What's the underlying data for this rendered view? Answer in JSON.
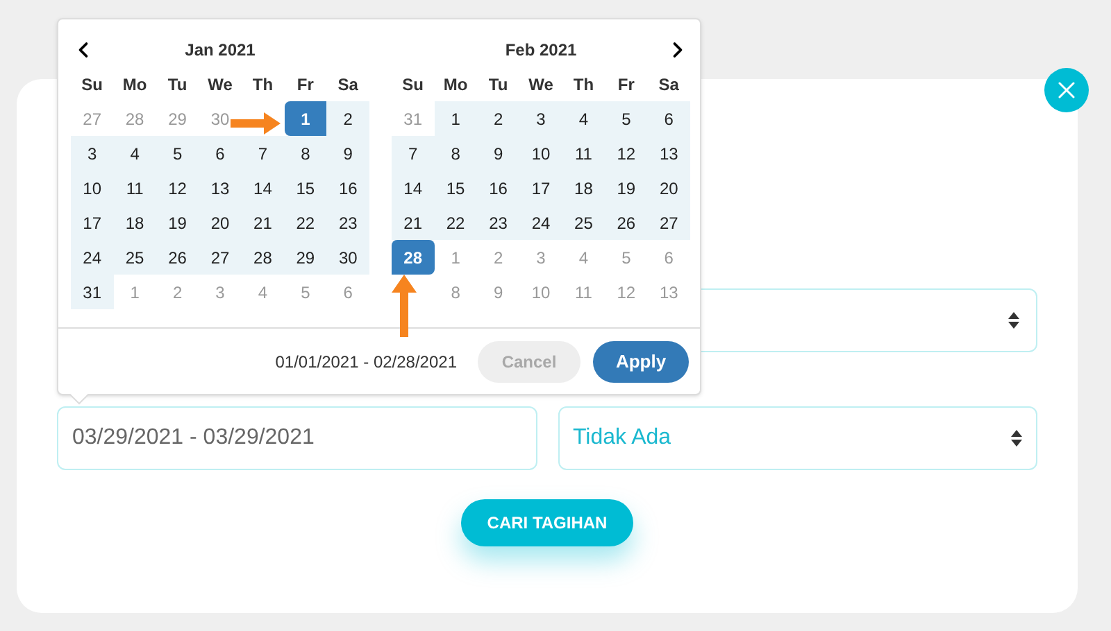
{
  "date_picker": {
    "months": [
      {
        "title": "Jan 2021",
        "weekdays": [
          "Su",
          "Mo",
          "Tu",
          "We",
          "Th",
          "Fr",
          "Sa"
        ],
        "days": [
          {
            "day": "27",
            "kind": "off"
          },
          {
            "day": "28",
            "kind": "off"
          },
          {
            "day": "29",
            "kind": "off"
          },
          {
            "day": "30",
            "kind": "off"
          },
          {
            "kind": "blank"
          },
          {
            "day": "1",
            "kind": "start"
          },
          {
            "day": "2",
            "kind": "range"
          },
          {
            "day": "3",
            "kind": "range"
          },
          {
            "day": "4",
            "kind": "range"
          },
          {
            "day": "5",
            "kind": "range"
          },
          {
            "day": "6",
            "kind": "range"
          },
          {
            "day": "7",
            "kind": "range"
          },
          {
            "day": "8",
            "kind": "range"
          },
          {
            "day": "9",
            "kind": "range"
          },
          {
            "day": "10",
            "kind": "range"
          },
          {
            "day": "11",
            "kind": "range"
          },
          {
            "day": "12",
            "kind": "range"
          },
          {
            "day": "13",
            "kind": "range"
          },
          {
            "day": "14",
            "kind": "range"
          },
          {
            "day": "15",
            "kind": "range"
          },
          {
            "day": "16",
            "kind": "range"
          },
          {
            "day": "17",
            "kind": "range"
          },
          {
            "day": "18",
            "kind": "range"
          },
          {
            "day": "19",
            "kind": "range"
          },
          {
            "day": "20",
            "kind": "range"
          },
          {
            "day": "21",
            "kind": "range"
          },
          {
            "day": "22",
            "kind": "range"
          },
          {
            "day": "23",
            "kind": "range"
          },
          {
            "day": "24",
            "kind": "range"
          },
          {
            "day": "25",
            "kind": "range"
          },
          {
            "day": "26",
            "kind": "range"
          },
          {
            "day": "27",
            "kind": "range"
          },
          {
            "day": "28",
            "kind": "range"
          },
          {
            "day": "29",
            "kind": "range"
          },
          {
            "day": "30",
            "kind": "range"
          },
          {
            "day": "31",
            "kind": "range"
          },
          {
            "day": "1",
            "kind": "off"
          },
          {
            "day": "2",
            "kind": "off"
          },
          {
            "day": "3",
            "kind": "off"
          },
          {
            "day": "4",
            "kind": "off"
          },
          {
            "day": "5",
            "kind": "off"
          },
          {
            "day": "6",
            "kind": "off"
          }
        ]
      },
      {
        "title": "Feb 2021",
        "weekdays": [
          "Su",
          "Mo",
          "Tu",
          "We",
          "Th",
          "Fr",
          "Sa"
        ],
        "days": [
          {
            "day": "31",
            "kind": "off"
          },
          {
            "day": "1",
            "kind": "range"
          },
          {
            "day": "2",
            "kind": "range"
          },
          {
            "day": "3",
            "kind": "range"
          },
          {
            "day": "4",
            "kind": "range"
          },
          {
            "day": "5",
            "kind": "range"
          },
          {
            "day": "6",
            "kind": "range"
          },
          {
            "day": "7",
            "kind": "range"
          },
          {
            "day": "8",
            "kind": "range"
          },
          {
            "day": "9",
            "kind": "range"
          },
          {
            "day": "10",
            "kind": "range"
          },
          {
            "day": "11",
            "kind": "range"
          },
          {
            "day": "12",
            "kind": "range"
          },
          {
            "day": "13",
            "kind": "range"
          },
          {
            "day": "14",
            "kind": "range"
          },
          {
            "day": "15",
            "kind": "range"
          },
          {
            "day": "16",
            "kind": "range"
          },
          {
            "day": "17",
            "kind": "range"
          },
          {
            "day": "18",
            "kind": "range"
          },
          {
            "day": "19",
            "kind": "range"
          },
          {
            "day": "20",
            "kind": "range"
          },
          {
            "day": "21",
            "kind": "range"
          },
          {
            "day": "22",
            "kind": "range"
          },
          {
            "day": "23",
            "kind": "range"
          },
          {
            "day": "24",
            "kind": "range"
          },
          {
            "day": "25",
            "kind": "range"
          },
          {
            "day": "26",
            "kind": "range"
          },
          {
            "day": "27",
            "kind": "range"
          },
          {
            "day": "28",
            "kind": "end"
          },
          {
            "day": "1",
            "kind": "off"
          },
          {
            "day": "2",
            "kind": "off"
          },
          {
            "day": "3",
            "kind": "off"
          },
          {
            "day": "4",
            "kind": "off"
          },
          {
            "day": "5",
            "kind": "off"
          },
          {
            "day": "6",
            "kind": "off"
          },
          {
            "kind": "blank"
          },
          {
            "day": "8",
            "kind": "off"
          },
          {
            "day": "9",
            "kind": "off"
          },
          {
            "day": "10",
            "kind": "off"
          },
          {
            "day": "11",
            "kind": "off"
          },
          {
            "day": "12",
            "kind": "off"
          },
          {
            "day": "13",
            "kind": "off"
          }
        ]
      }
    ],
    "selected_range": "01/01/2021 - 02/28/2021",
    "cancel": {
      "label": "Cancel",
      "disabled": true
    },
    "apply": {
      "label": "Apply",
      "disabled": false
    }
  },
  "date_field": {
    "value": "03/29/2021 - 03/29/2021"
  },
  "status_select": {
    "value": "Tidak Ada"
  },
  "search_button": "CARI TAGIHAN"
}
